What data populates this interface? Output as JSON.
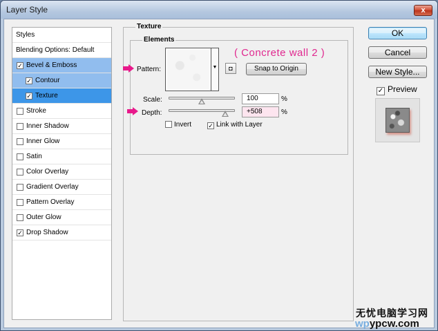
{
  "window": {
    "title": "Layer Style",
    "close_label": "x"
  },
  "styles_list": {
    "header": "Styles",
    "items": [
      {
        "label": "Blending Options: Default",
        "checkbox": false,
        "checked": false,
        "level": 0,
        "selected": ""
      },
      {
        "label": "Bevel & Emboss",
        "checkbox": true,
        "checked": true,
        "level": 0,
        "selected": "light"
      },
      {
        "label": "Contour",
        "checkbox": true,
        "checked": true,
        "level": 1,
        "selected": "light"
      },
      {
        "label": "Texture",
        "checkbox": true,
        "checked": true,
        "level": 1,
        "selected": "active"
      },
      {
        "label": "Stroke",
        "checkbox": true,
        "checked": false,
        "level": 0,
        "selected": ""
      },
      {
        "label": "Inner Shadow",
        "checkbox": true,
        "checked": false,
        "level": 0,
        "selected": ""
      },
      {
        "label": "Inner Glow",
        "checkbox": true,
        "checked": false,
        "level": 0,
        "selected": ""
      },
      {
        "label": "Satin",
        "checkbox": true,
        "checked": false,
        "level": 0,
        "selected": ""
      },
      {
        "label": "Color Overlay",
        "checkbox": true,
        "checked": false,
        "level": 0,
        "selected": ""
      },
      {
        "label": "Gradient Overlay",
        "checkbox": true,
        "checked": false,
        "level": 0,
        "selected": ""
      },
      {
        "label": "Pattern Overlay",
        "checkbox": true,
        "checked": false,
        "level": 0,
        "selected": ""
      },
      {
        "label": "Outer Glow",
        "checkbox": true,
        "checked": false,
        "level": 0,
        "selected": ""
      },
      {
        "label": "Drop Shadow",
        "checkbox": true,
        "checked": true,
        "level": 0,
        "selected": ""
      }
    ]
  },
  "texture": {
    "group_title": "Texture",
    "elements_title": "Elements",
    "pattern_label": "Pattern:",
    "snap_button": "Snap to Origin",
    "annotation": "( Concrete wall 2 )",
    "scale_label": "Scale:",
    "scale_value": "100",
    "scale_level": 0.5,
    "depth_label": "Depth:",
    "depth_value": "+508",
    "depth_level": 0.85,
    "percent": "%",
    "invert_label": "Invert",
    "invert_checked": false,
    "link_label": "Link with Layer",
    "link_checked": true
  },
  "buttons": {
    "ok": "OK",
    "cancel": "Cancel",
    "new_style": "New Style..."
  },
  "preview": {
    "label": "Preview",
    "checked": true
  },
  "watermark": {
    "line1": "无忧电脑学习网",
    "line2_a": "wp",
    "line2_b": "ypcw.com"
  },
  "colors": {
    "selection_light": "#91bdee",
    "selection_active": "#3d96e8",
    "annotation": "#e0288f",
    "arrow": "#e8198b"
  }
}
